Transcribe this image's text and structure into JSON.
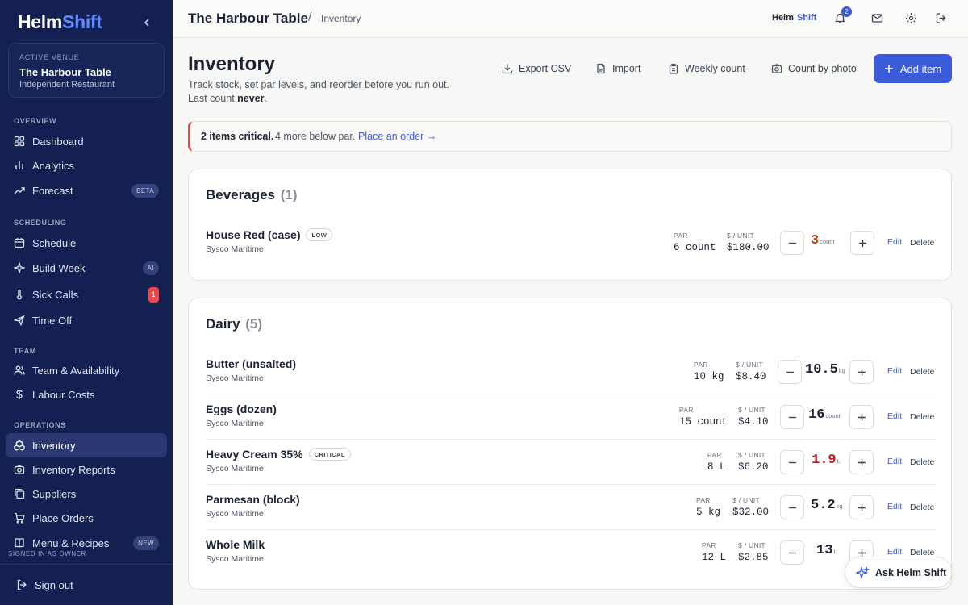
{
  "brand": {
    "part1": "Helm",
    "part2": "Shift"
  },
  "venue": {
    "kicker": "ACTIVE VENUE",
    "name": "The Harbour Table",
    "type": "Independent Restaurant"
  },
  "sidebar": {
    "sections": [
      {
        "title": "OVERVIEW"
      },
      {
        "title": "SCHEDULING"
      },
      {
        "title": "TEAM"
      },
      {
        "title": "OPERATIONS"
      }
    ],
    "items": [
      {
        "label": "Dashboard",
        "icon": "grid-icon"
      },
      {
        "label": "Analytics",
        "icon": "bar-chart-icon"
      },
      {
        "label": "Forecast",
        "icon": "trend-up-icon",
        "badge": "BETA"
      },
      {
        "label": "Schedule",
        "icon": "calendar-icon"
      },
      {
        "label": "Build Week",
        "icon": "sparkle-icon",
        "badge": "AI"
      },
      {
        "label": "Sick Calls",
        "icon": "thermometer-icon",
        "badge": "1"
      },
      {
        "label": "Time Off",
        "icon": "plane-icon"
      },
      {
        "label": "Team & Availability",
        "icon": "users-icon"
      },
      {
        "label": "Labour Costs",
        "icon": "dollar-icon"
      },
      {
        "label": "Inventory",
        "icon": "boxes-icon",
        "active": true
      },
      {
        "label": "Inventory Reports",
        "icon": "camera-icon"
      },
      {
        "label": "Suppliers",
        "icon": "copy-icon"
      },
      {
        "label": "Place Orders",
        "icon": "cart-icon"
      },
      {
        "label": "Menu & Recipes",
        "icon": "book-icon",
        "badge": "NEW"
      }
    ],
    "signed_in": "SIGNED IN AS OWNER",
    "sign_out": "Sign out"
  },
  "topbar": {
    "venue": "The Harbour Table",
    "separator": "/",
    "page": "Inventory",
    "mini_brand_1": "Helm",
    "mini_brand_2": "Shift",
    "notifications": "2"
  },
  "header": {
    "title": "Inventory",
    "subtitle": "Track stock, set par levels, and reorder before you run out.",
    "last_count_prefix": "Last count ",
    "last_count_value": "never",
    "last_count_suffix": ".",
    "actions": {
      "export": "Export CSV",
      "import": "Import",
      "weekly": "Weekly count",
      "photo": "Count by photo",
      "add": "Add item"
    }
  },
  "alert": {
    "critical": "2 items critical.",
    "below": "4 more below par.",
    "link": "Place an order →"
  },
  "labels": {
    "par": "PAR",
    "unit": "$ / UNIT",
    "edit": "Edit",
    "delete": "Delete"
  },
  "categories": [
    {
      "name": "Beverages",
      "count": "(1)",
      "items": [
        {
          "name": "House Red (case)",
          "tag": "LOW",
          "supplier": "Sysco Maritime",
          "par": "6 count",
          "price": "$180.00",
          "qty": "3",
          "unit": "count",
          "status": "low"
        }
      ]
    },
    {
      "name": "Dairy",
      "count": "(5)",
      "items": [
        {
          "name": "Butter (unsalted)",
          "supplier": "Sysco Maritime",
          "par": "10 kg",
          "price": "$8.40",
          "qty": "10.5",
          "unit": "kg"
        },
        {
          "name": "Eggs (dozen)",
          "supplier": "Sysco Maritime",
          "par": "15 count",
          "price": "$4.10",
          "qty": "16",
          "unit": "count"
        },
        {
          "name": "Heavy Cream 35%",
          "tag": "CRITICAL",
          "supplier": "Sysco Maritime",
          "par": "8 L",
          "price": "$6.20",
          "qty": "1.9",
          "unit": "L",
          "status": "critical"
        },
        {
          "name": "Parmesan (block)",
          "supplier": "Sysco Maritime",
          "par": "5 kg",
          "price": "$32.00",
          "qty": "5.2",
          "unit": "kg"
        },
        {
          "name": "Whole Milk",
          "supplier": "Sysco Maritime",
          "par": "12 L",
          "price": "$2.85",
          "qty": "13",
          "unit": "L"
        }
      ]
    }
  ],
  "assistant": {
    "label": "Ask Helm Shift"
  },
  "colors": {
    "sidebar": "#142052",
    "accent": "#3b5bdb",
    "critical": "#e5484d",
    "low": "#c2410c"
  }
}
